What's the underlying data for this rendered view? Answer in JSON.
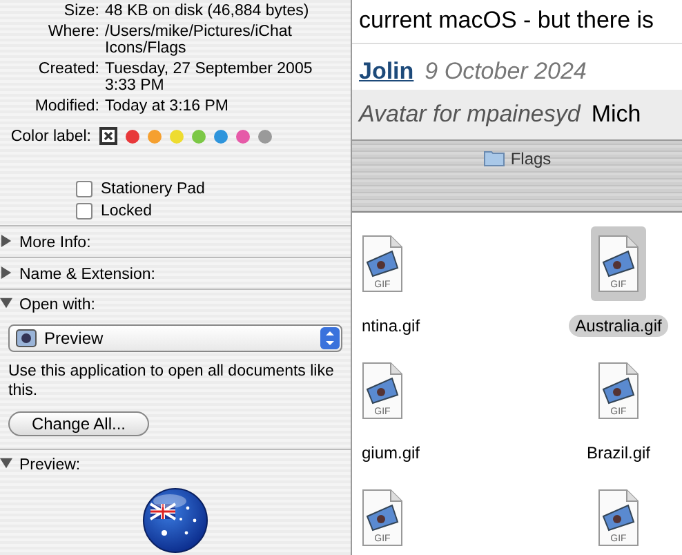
{
  "info_panel": {
    "fields": [
      {
        "label": "Size:",
        "value": "48 KB on disk (46,884 bytes)"
      },
      {
        "label": "Where:",
        "value": "/Users/mike/Pictures/iChat Icons/Flags"
      },
      {
        "label": "Created:",
        "value": "Tuesday, 27 September 2005 3:33 PM"
      },
      {
        "label": "Modified:",
        "value": "Today at 3:16 PM"
      }
    ],
    "color_label": {
      "label": "Color label:",
      "colors": [
        {
          "color": "#e8383a",
          "selected": false
        },
        {
          "color": "#f5a030",
          "selected": false
        },
        {
          "color": "#eedc30",
          "selected": false
        },
        {
          "color": "#7cc846",
          "selected": false
        },
        {
          "color": "#2f95dc",
          "selected": false
        },
        {
          "color": "#e65aa8",
          "selected": false
        },
        {
          "color": "#9a9a9a",
          "selected": false
        }
      ]
    },
    "checkboxes": [
      {
        "label": "Stationery Pad",
        "checked": false
      },
      {
        "label": "Locked",
        "checked": false
      }
    ],
    "sections": [
      {
        "kind": "plain",
        "title": "More Info:",
        "expanded": false
      },
      {
        "kind": "plain",
        "title": "Name & Extension:",
        "expanded": false
      },
      {
        "kind": "open_with",
        "title": "Open with:",
        "expanded": true,
        "app": "Preview",
        "note": "Use this application to open all documents like this.",
        "button": "Change All..."
      },
      {
        "kind": "preview",
        "title": "Preview:",
        "expanded": true
      }
    ]
  },
  "web_page": {
    "text": "current macOS - but there is",
    "author": "Jolin",
    "date": "9 October 2024",
    "avatar_text": "Avatar for mpainesyd",
    "name_text": "Mich"
  },
  "finder": {
    "title": "Flags",
    "files": [
      {
        "name": "ntina.gif",
        "type": "GIF",
        "selected": false
      },
      {
        "name": "Australia.gif",
        "type": "GIF",
        "selected": true
      },
      {
        "name": "gium.gif",
        "type": "GIF",
        "selected": false
      },
      {
        "name": "Brazil.gif",
        "type": "GIF",
        "selected": false
      },
      {
        "type": "GIF",
        "selected": false
      },
      {
        "type": "GIF",
        "selected": false
      }
    ]
  }
}
